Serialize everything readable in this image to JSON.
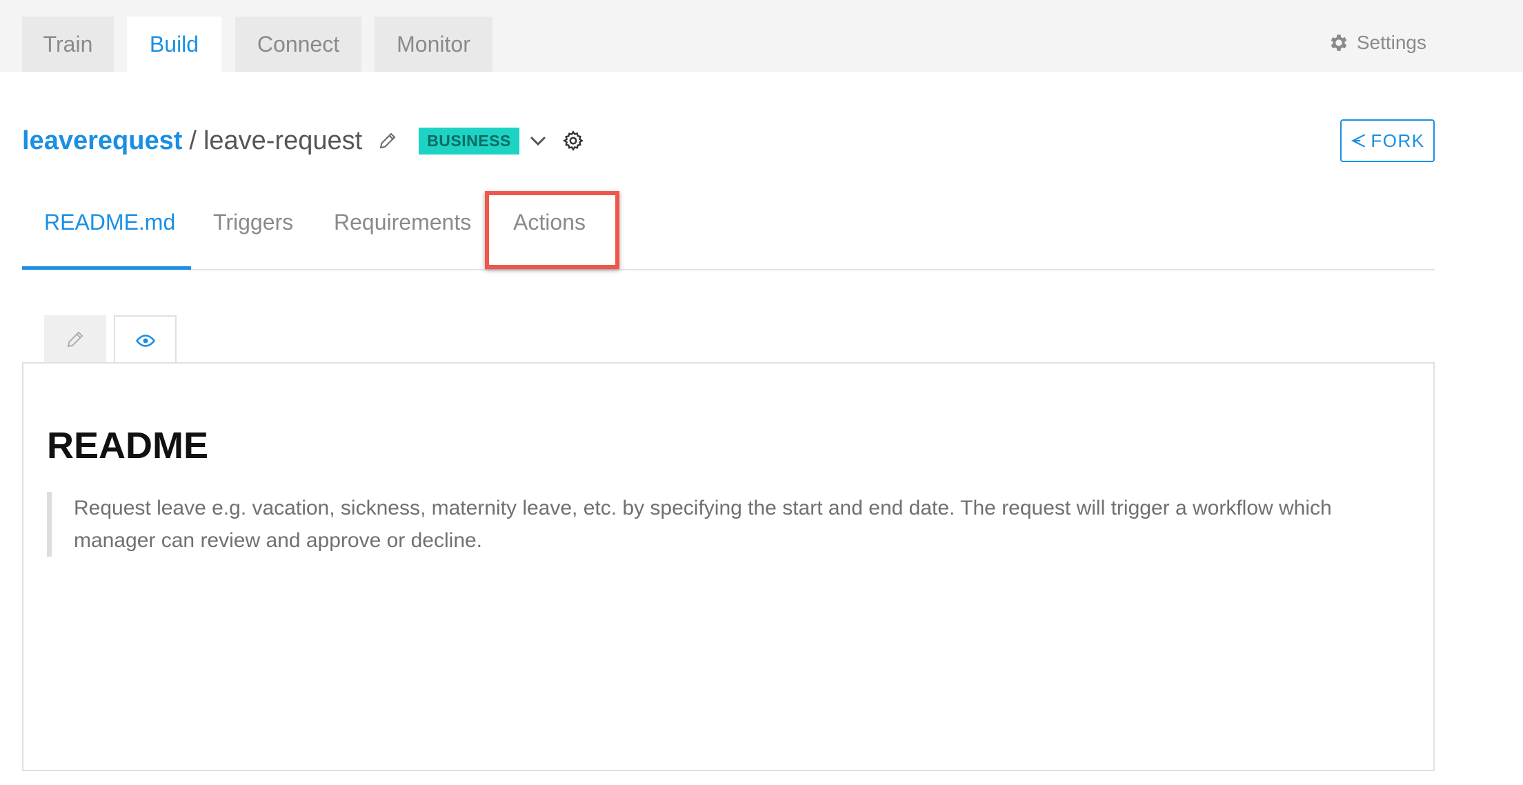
{
  "top_nav": {
    "tabs": [
      {
        "label": "Train"
      },
      {
        "label": "Build"
      },
      {
        "label": "Connect"
      },
      {
        "label": "Monitor"
      }
    ],
    "active_tab": "Build",
    "settings_label": "Settings"
  },
  "header": {
    "project": "leaverequest",
    "separator": "/",
    "bot_name": "leave-request",
    "badge": "BUSINESS",
    "fork_label": "FORK"
  },
  "sub_tabs": {
    "items": [
      {
        "label": "README.md"
      },
      {
        "label": "Triggers"
      },
      {
        "label": "Requirements"
      },
      {
        "label": "Actions"
      }
    ],
    "active": "README.md",
    "highlighted": "Actions"
  },
  "content": {
    "heading": "README",
    "quote": "Request leave e.g. vacation, sickness, maternity leave, etc. by specifying the start and end date. The request will trigger a workflow which manager can review and approve or decline."
  },
  "colors": {
    "accent": "#1a8fe3",
    "badge_bg": "#1dd3c4",
    "highlight": "#f0564a"
  }
}
